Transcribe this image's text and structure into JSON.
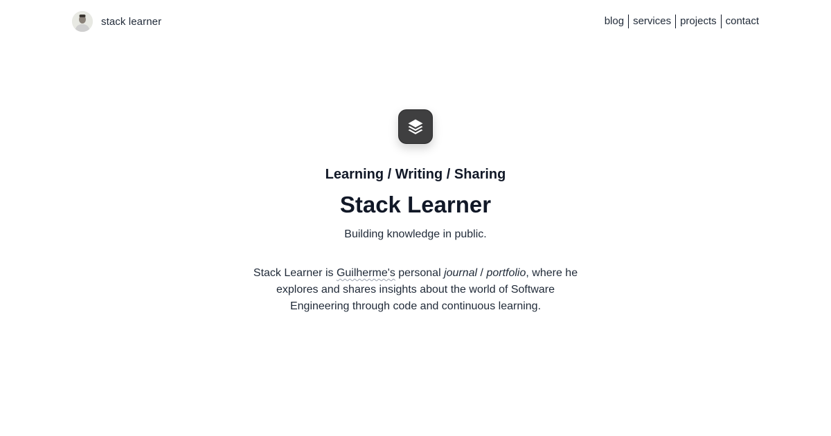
{
  "header": {
    "brand_name": "stack learner",
    "avatar_icon": "person-avatar",
    "nav": [
      {
        "label": "blog"
      },
      {
        "label": "services"
      },
      {
        "label": "projects"
      },
      {
        "label": "contact"
      }
    ]
  },
  "hero": {
    "logo_icon": "layers-icon",
    "tagline": "Learning / Writing / Sharing",
    "title": "Stack Learner",
    "subtitle": "Building knowledge in public.",
    "description": {
      "part1": "Stack Learner is ",
      "name": "Guilherme's",
      "part2": " personal ",
      "em1": "journal",
      "slash": " / ",
      "em2": "portfolio",
      "part3": ", where he explores and shares insights about the world of Software Engineering through code and continuous learning."
    }
  }
}
